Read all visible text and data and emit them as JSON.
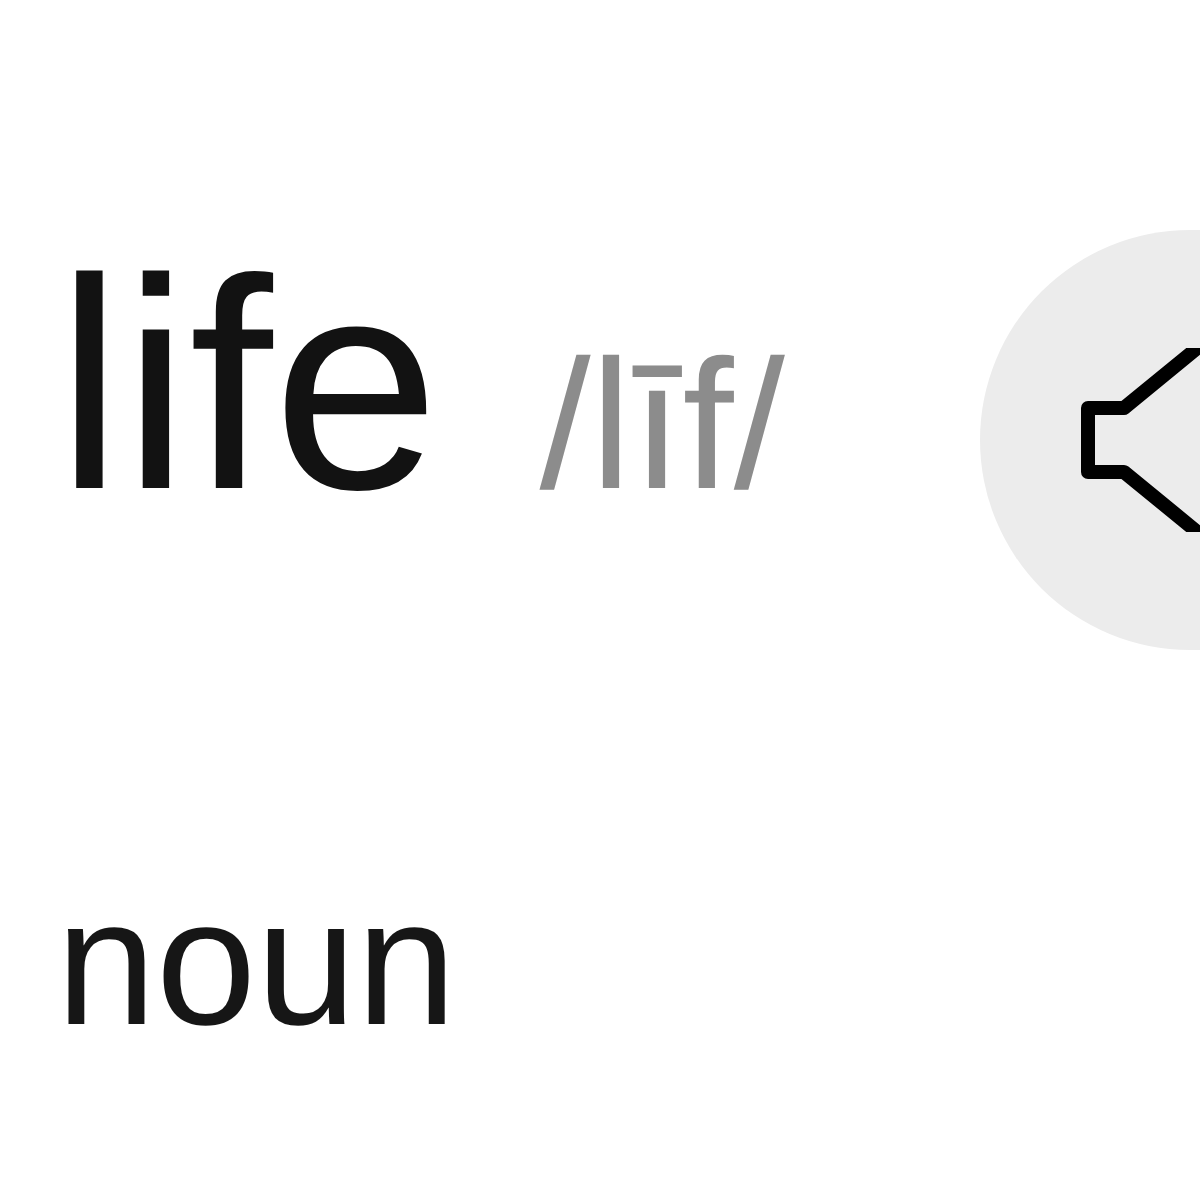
{
  "entry": {
    "word": "life",
    "pronunciation": "/līf/"
  },
  "part_of_speech": "noun"
}
